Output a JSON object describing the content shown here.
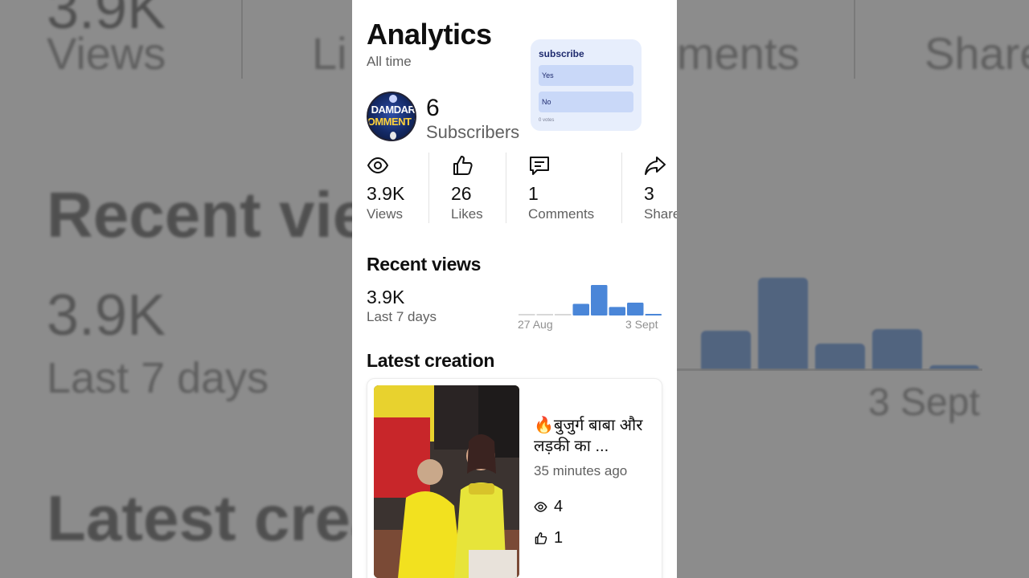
{
  "header": {
    "title": "Analytics",
    "subtitle": "All time"
  },
  "poll": {
    "question": "subscribe",
    "options": [
      "Yes",
      "No"
    ],
    "votes": "0 votes"
  },
  "channel": {
    "avatar_text_line1": "DAMDAR",
    "avatar_text_line2": "OMMENT 1",
    "subscriber_count": "6",
    "subscriber_label": "Subscribers"
  },
  "stats": [
    {
      "icon": "eye-icon",
      "value": "3.9K",
      "label": "Views"
    },
    {
      "icon": "thumbs-up-icon",
      "value": "26",
      "label": "Likes"
    },
    {
      "icon": "comment-icon",
      "value": "1",
      "label": "Comments"
    },
    {
      "icon": "share-icon",
      "value": "3",
      "label": "Shares"
    }
  ],
  "recent_views": {
    "heading": "Recent views",
    "value": "3.9K",
    "label": "Last 7 days",
    "axis_start": "27 Aug",
    "axis_end": "3 Sept"
  },
  "chart_data": {
    "type": "bar",
    "x_start": "27 Aug",
    "x_end": "3 Sept",
    "values": [
      0,
      0,
      0,
      0.38,
      1.0,
      0.28,
      0.42,
      0.03
    ],
    "value_unit": "fraction of the tallest bar (no value scale shown)",
    "color": "#4a86d8",
    "baseline_color": "#d8d8d8"
  },
  "latest": {
    "heading": "Latest creation",
    "video_title": "🔥बुजुर्ग बाबा और लड़की का ...",
    "time": "35 minutes ago",
    "views": "4",
    "likes": "1"
  },
  "background": {
    "row1": [
      "Views",
      "Li",
      "ments",
      "Share"
    ],
    "heading1": "Recent vie",
    "value": "3.9K",
    "label": "Last 7 days",
    "axis_end": "3 Sept",
    "heading2": "Latest crea"
  }
}
